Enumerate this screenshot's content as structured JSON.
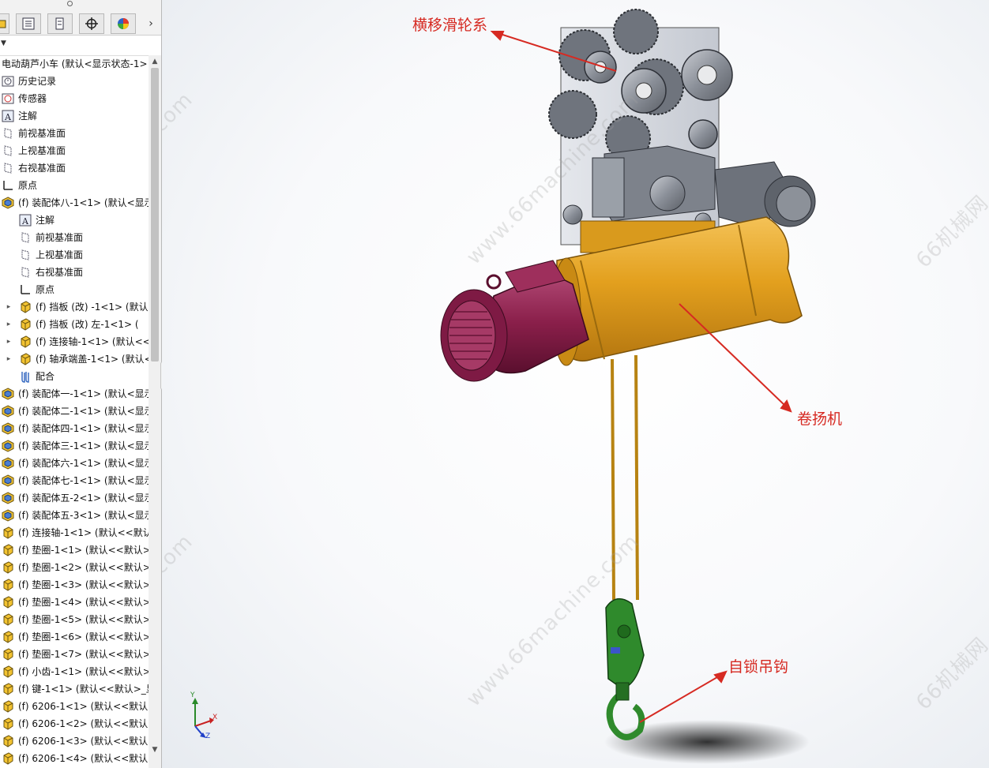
{
  "feature_tree": {
    "root": "电动葫芦小车  (默认<显示状态-1>",
    "nodes": [
      {
        "label": "历史记录",
        "icon": "history-icon",
        "level": 0
      },
      {
        "label": "传感器",
        "icon": "sensor-icon",
        "level": 0
      },
      {
        "label": "注解",
        "icon": "annotation-icon",
        "level": 0
      },
      {
        "label": "前视基准面",
        "icon": "plane-icon",
        "level": 0
      },
      {
        "label": "上视基准面",
        "icon": "plane-icon",
        "level": 0
      },
      {
        "label": "右视基准面",
        "icon": "plane-icon",
        "level": 0
      },
      {
        "label": "原点",
        "icon": "origin-icon",
        "level": 0
      },
      {
        "label": "(f) 装配体八-1<1> (默认<显示",
        "icon": "assembly-icon",
        "level": 0
      },
      {
        "label": "注解",
        "icon": "annotation-icon",
        "level": 1
      },
      {
        "label": "前视基准面",
        "icon": "plane-icon",
        "level": 1
      },
      {
        "label": "上视基准面",
        "icon": "plane-icon",
        "level": 1
      },
      {
        "label": "右视基准面",
        "icon": "plane-icon",
        "level": 1
      },
      {
        "label": "原点",
        "icon": "origin-icon",
        "level": 1
      },
      {
        "label": "(f) 挡板 (改) -1<1> (默认",
        "icon": "part-icon",
        "level": 1,
        "expander": true
      },
      {
        "label": "(f) 挡板 (改) 左-1<1> (",
        "icon": "part-icon",
        "level": 1,
        "expander": true
      },
      {
        "label": "(f) 连接轴-1<1> (默认<<",
        "icon": "part-icon",
        "level": 1,
        "expander": true
      },
      {
        "label": "(f) 轴承端盖-1<1> (默认<",
        "icon": "part-icon",
        "level": 1,
        "expander": true
      },
      {
        "label": "配合",
        "icon": "mate-icon",
        "level": 1
      },
      {
        "label": "(f) 装配体一-1<1> (默认<显示",
        "icon": "assembly-icon",
        "level": 0
      },
      {
        "label": "(f) 装配体二-1<1> (默认<显示",
        "icon": "assembly-icon",
        "level": 0
      },
      {
        "label": "(f) 装配体四-1<1> (默认<显示",
        "icon": "assembly-icon",
        "level": 0
      },
      {
        "label": "(f) 装配体三-1<1> (默认<显示",
        "icon": "assembly-icon",
        "level": 0
      },
      {
        "label": "(f) 装配体六-1<1> (默认<显示",
        "icon": "assembly-icon",
        "level": 0
      },
      {
        "label": "(f) 装配体七-1<1> (默认<显示",
        "icon": "assembly-icon",
        "level": 0
      },
      {
        "label": "(f) 装配体五-2<1> (默认<显示",
        "icon": "assembly-icon",
        "level": 0
      },
      {
        "label": "(f) 装配体五-3<1> (默认<显示",
        "icon": "assembly-icon",
        "level": 0
      },
      {
        "label": "(f) 连接轴-1<1> (默认<<默认",
        "icon": "part-icon",
        "level": 0
      },
      {
        "label": "(f) 垫圈-1<1> (默认<<默认>_",
        "icon": "part-icon",
        "level": 0
      },
      {
        "label": "(f) 垫圈-1<2> (默认<<默认>_",
        "icon": "part-icon",
        "level": 0
      },
      {
        "label": "(f) 垫圈-1<3> (默认<<默认>_",
        "icon": "part-icon",
        "level": 0
      },
      {
        "label": "(f) 垫圈-1<4> (默认<<默认>_",
        "icon": "part-icon",
        "level": 0
      },
      {
        "label": "(f) 垫圈-1<5> (默认<<默认>_",
        "icon": "part-icon",
        "level": 0
      },
      {
        "label": "(f) 垫圈-1<6> (默认<<默认>_",
        "icon": "part-icon",
        "level": 0
      },
      {
        "label": "(f) 垫圈-1<7> (默认<<默认>_",
        "icon": "part-icon",
        "level": 0
      },
      {
        "label": "(f) 小齿-1<1> (默认<<默认>_",
        "icon": "part-icon",
        "level": 0
      },
      {
        "label": "(f) 键-1<1> (默认<<默认>_显",
        "icon": "part-icon",
        "level": 0
      },
      {
        "label": "(f) 6206-1<1> (默认<<默认>_",
        "icon": "part-icon",
        "level": 0
      },
      {
        "label": "(f) 6206-1<2> (默认<<默认>_",
        "icon": "part-icon",
        "level": 0
      },
      {
        "label": "(f) 6206-1<3> (默认<<默认>_",
        "icon": "part-icon",
        "level": 0
      },
      {
        "label": "(f) 6206-1<4> (默认<<默认>_",
        "icon": "part-icon",
        "level": 0
      }
    ]
  },
  "viewport": {
    "callouts": {
      "traverse_pulley": "横移滑轮系",
      "winch": "卷扬机",
      "hook": "自锁吊钩"
    },
    "watermark_site": "www.66machine.com",
    "watermark_brand": "66机械网",
    "triad": {
      "x": "X",
      "y": "Y",
      "z": "Z"
    }
  },
  "colors": {
    "callout": "#d62a22",
    "drum": "#e6a21f",
    "motor": "#8a1f4a",
    "hook": "#2f8a2c",
    "steel": "#8a8f98"
  }
}
